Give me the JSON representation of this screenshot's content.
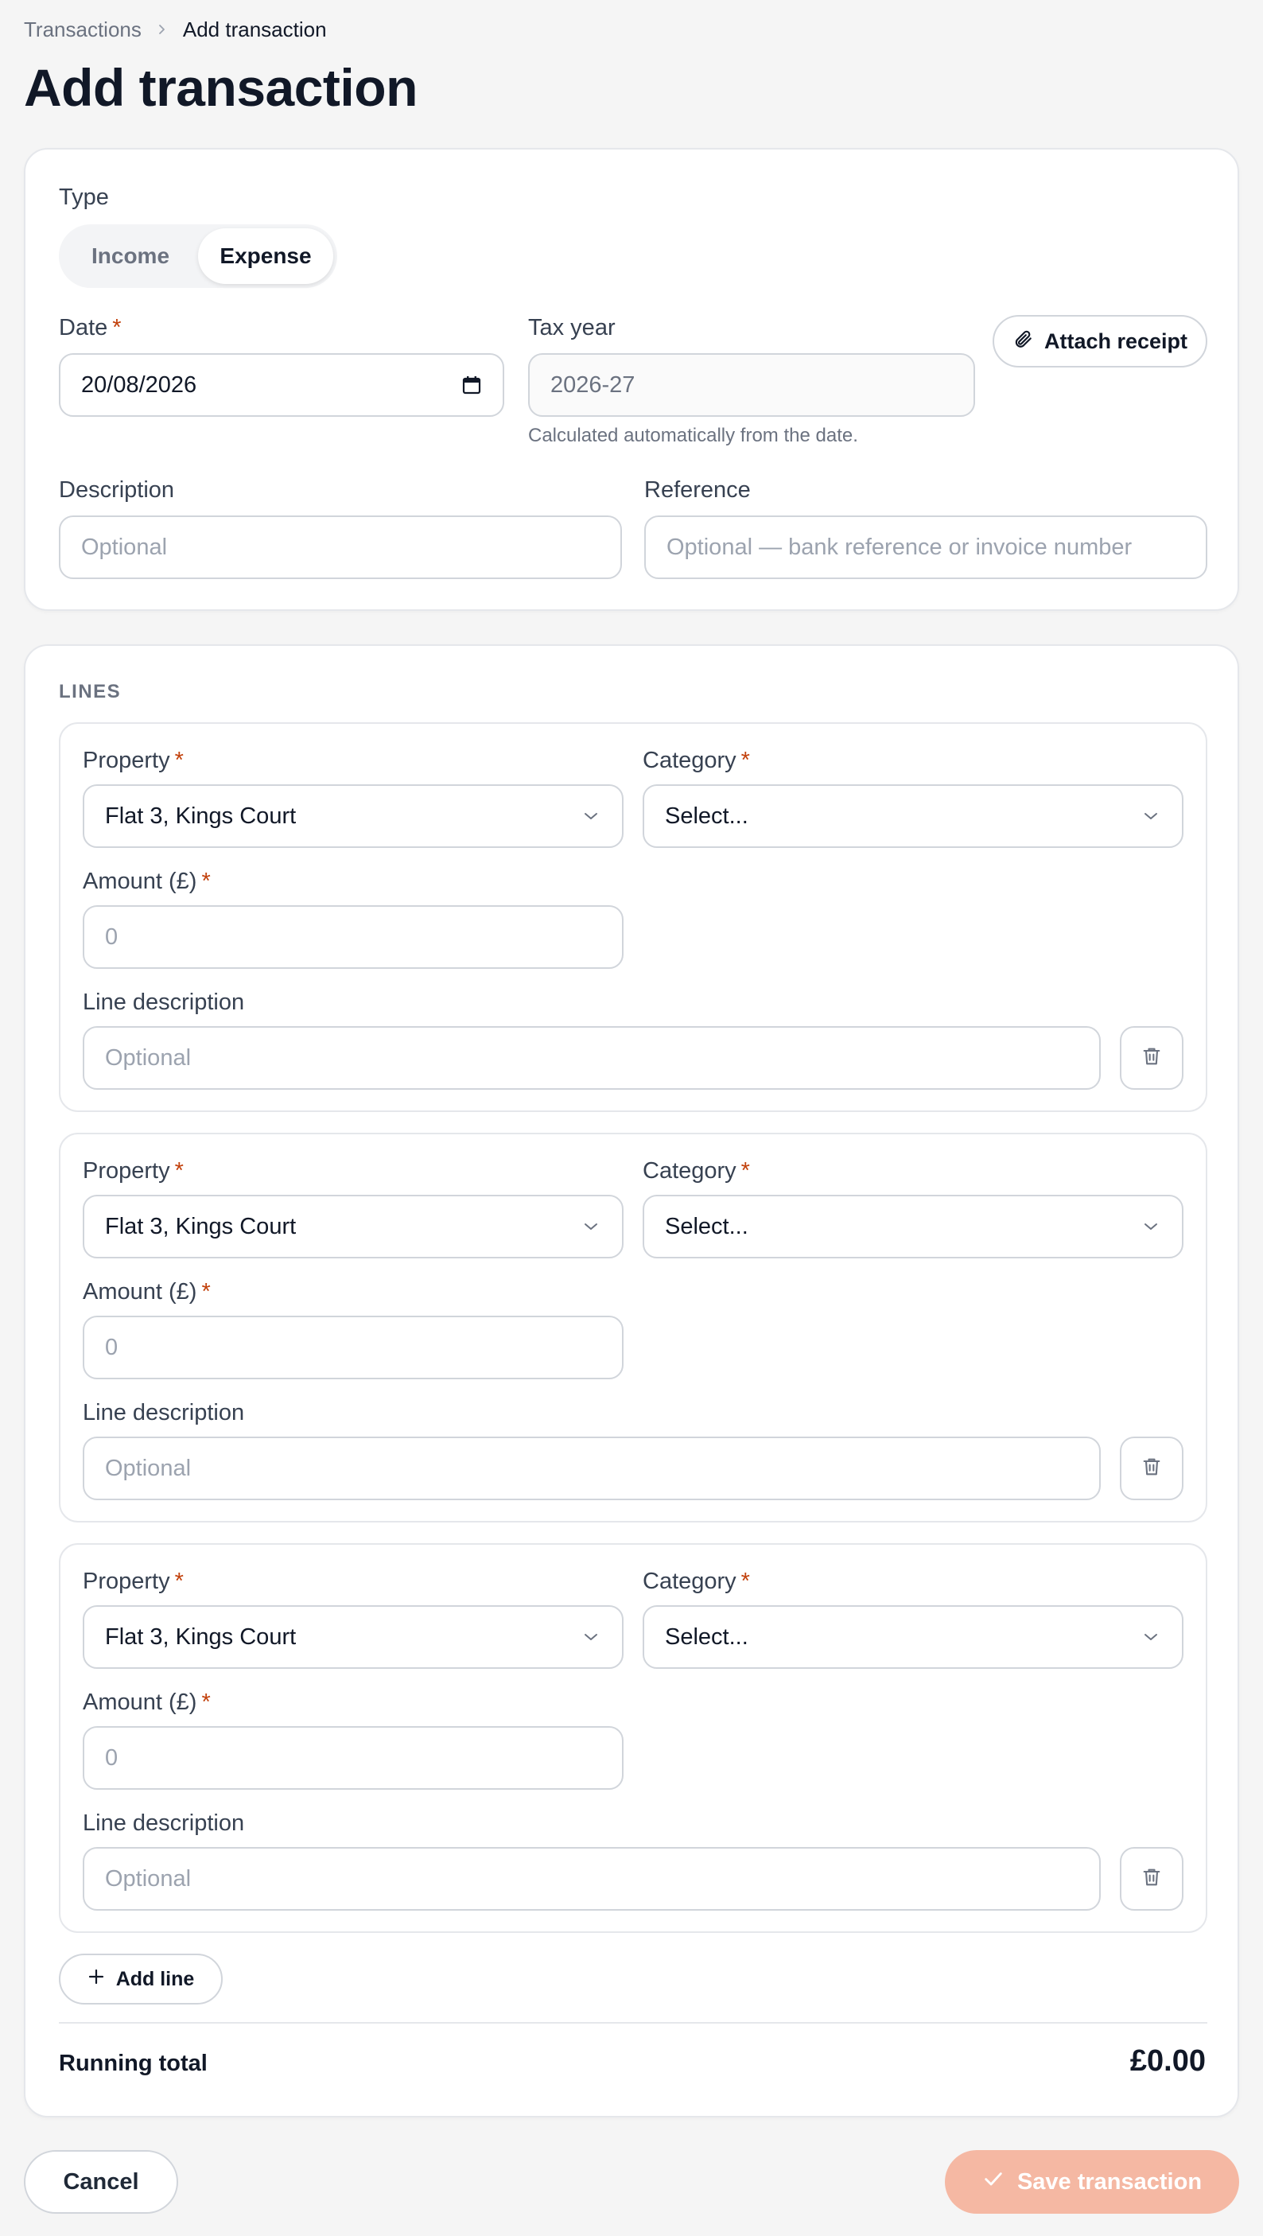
{
  "breadcrumb": {
    "parent": "Transactions",
    "current": "Add transaction"
  },
  "page_title": "Add transaction",
  "form": {
    "type_label": "Type",
    "type_options": [
      "Income",
      "Expense"
    ],
    "type_selected": "Expense",
    "date_label": "Date",
    "date_value": "20/08/2026",
    "tax_year_label": "Tax year",
    "tax_year_value": "2026-27",
    "tax_year_hint": "Calculated automatically from the date.",
    "attach_receipt": "Attach receipt",
    "description_label": "Description",
    "description_placeholder": "Optional",
    "reference_label": "Reference",
    "reference_placeholder": "Optional — bank reference or invoice number",
    "required_mark": "*"
  },
  "lines": {
    "section_label": "LINES",
    "items": [
      {
        "property_label": "Property",
        "property_value": "Flat 3, Kings Court",
        "category_label": "Category",
        "category_value": "Select...",
        "amount_label": "Amount (£)",
        "amount_placeholder": "0",
        "desc_label": "Line description",
        "desc_placeholder": "Optional"
      },
      {
        "property_label": "Property",
        "property_value": "Flat 3, Kings Court",
        "category_label": "Category",
        "category_value": "Select...",
        "amount_label": "Amount (£)",
        "amount_placeholder": "0",
        "desc_label": "Line description",
        "desc_placeholder": "Optional"
      },
      {
        "property_label": "Property",
        "property_value": "Flat 3, Kings Court",
        "category_label": "Category",
        "category_value": "Select...",
        "amount_label": "Amount (£)",
        "amount_placeholder": "0",
        "desc_label": "Line description",
        "desc_placeholder": "Optional"
      }
    ],
    "add_line": "Add line",
    "running_total_label": "Running total",
    "running_total_value": "£0.00"
  },
  "actions": {
    "cancel": "Cancel",
    "save": "Save transaction"
  },
  "icons": {
    "breadcrumb_separator": "chevron-right-icon",
    "date_picker": "calendar-icon",
    "attach": "paperclip-icon",
    "select": "chevron-down-icon",
    "remove_line": "trash-icon",
    "add": "plus-icon",
    "save": "check-icon"
  },
  "colors": {
    "required": "#c2410c",
    "save_disabled_bg": "#f5b8a3",
    "background": "#f5f5f5",
    "card_border": "#e5e7eb"
  }
}
